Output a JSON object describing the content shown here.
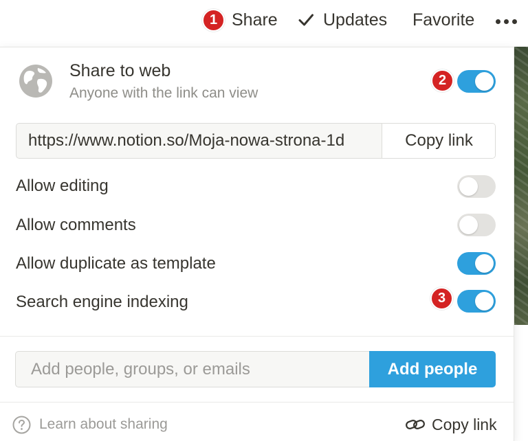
{
  "topbar": {
    "share_badge": "1",
    "share_label": "Share",
    "updates_label": "Updates",
    "favorite_label": "Favorite"
  },
  "share_to_web": {
    "title": "Share to web",
    "subtitle": "Anyone with the link can view",
    "badge": "2",
    "enabled": true
  },
  "link": {
    "url": "https://www.notion.so/Moja-nowa-strona-1d",
    "copy_label": "Copy link"
  },
  "options": [
    {
      "label": "Allow editing",
      "enabled": false
    },
    {
      "label": "Allow comments",
      "enabled": false
    },
    {
      "label": "Allow duplicate as template",
      "enabled": true
    },
    {
      "label": "Search engine indexing",
      "enabled": true,
      "badge": "3"
    }
  ],
  "invite": {
    "placeholder": "Add people, groups, or emails",
    "button_label": "Add people"
  },
  "footer": {
    "learn_label": "Learn about sharing",
    "copy_label": "Copy link"
  },
  "colors": {
    "accent": "#2ea0dd",
    "badge": "#d42323",
    "toggle_off": "#e3e2df",
    "text": "#37352f",
    "muted_text": "#9b9a97"
  },
  "icons": {
    "globe": "globe-icon",
    "check": "check-icon",
    "more": "more-dots-icon",
    "help": "help-circle-icon",
    "link": "link-icon"
  }
}
